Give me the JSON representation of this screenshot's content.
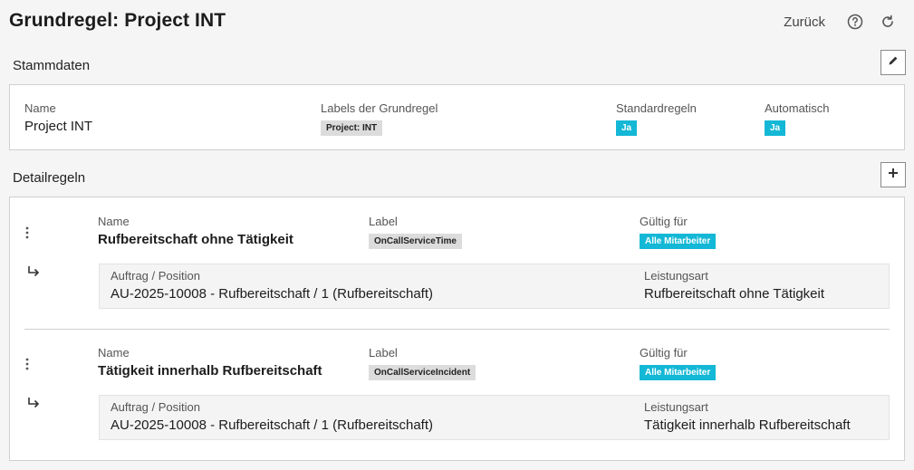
{
  "header": {
    "title": "Grundregel: Project INT",
    "back_label": "Zurück",
    "help_icon": "help-circle-icon",
    "refresh_icon": "refresh-icon"
  },
  "stammdaten": {
    "title": "Stammdaten",
    "edit_icon": "pencil-icon",
    "name_label": "Name",
    "name_value": "Project INT",
    "labels_label": "Labels der Grundregel",
    "labels_badge": "Project: INT",
    "standard_label": "Standardregeln",
    "standard_badge": "Ja",
    "auto_label": "Automatisch",
    "auto_badge": "Ja"
  },
  "detailregeln": {
    "title": "Detailregeln",
    "add_icon": "plus-icon",
    "rules": [
      {
        "name_label": "Name",
        "name_value": "Rufbereitschaft ohne Tätigkeit",
        "label_label": "Label",
        "label_badge": "OnCallServiceTime",
        "valid_label": "Gültig für",
        "valid_badge": "Alle Mitarbeiter",
        "order_label": "Auftrag / Position",
        "order_value": "AU-2025-10008 - Rufbereitschaft / 1 (Rufbereitschaft)",
        "service_label": "Leistungsart",
        "service_value": "Rufbereitschaft ohne Tätigkeit"
      },
      {
        "name_label": "Name",
        "name_value": "Tätigkeit innerhalb Rufbereitschaft",
        "label_label": "Label",
        "label_badge": "OnCallServiceIncident",
        "valid_label": "Gültig für",
        "valid_badge": "Alle Mitarbeiter",
        "order_label": "Auftrag / Position",
        "order_value": "AU-2025-10008 - Rufbereitschaft / 1 (Rufbereitschaft)",
        "service_label": "Leistungsart",
        "service_value": "Tätigkeit innerhalb Rufbereitschaft"
      }
    ]
  },
  "colors": {
    "accent_badge": "#14b8d6",
    "neutral_badge": "#dcdcdc",
    "background": "#f5f5f5"
  }
}
